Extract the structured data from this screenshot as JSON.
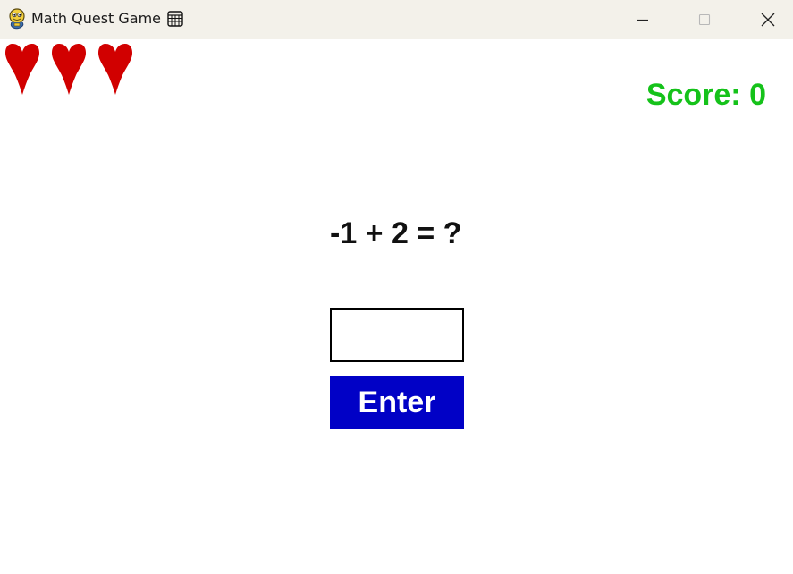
{
  "window": {
    "title": "Math Quest Game",
    "app_icon": "pygame-snake-icon",
    "ime_icon": "keyboard-grid-icon",
    "controls": {
      "minimize_icon": "minimize-icon",
      "maximize_icon": "maximize-icon",
      "close_icon": "close-icon"
    }
  },
  "game": {
    "lives": 3,
    "life_icon": "heart-icon",
    "score_text": "Score: 0",
    "question": "-1 + 2 = ?",
    "answer_value": "",
    "enter_label": "Enter"
  },
  "colors": {
    "heart": "#d10000",
    "score": "#15c21a",
    "button": "#0101c6",
    "titlebar": "#f3f1ea"
  }
}
